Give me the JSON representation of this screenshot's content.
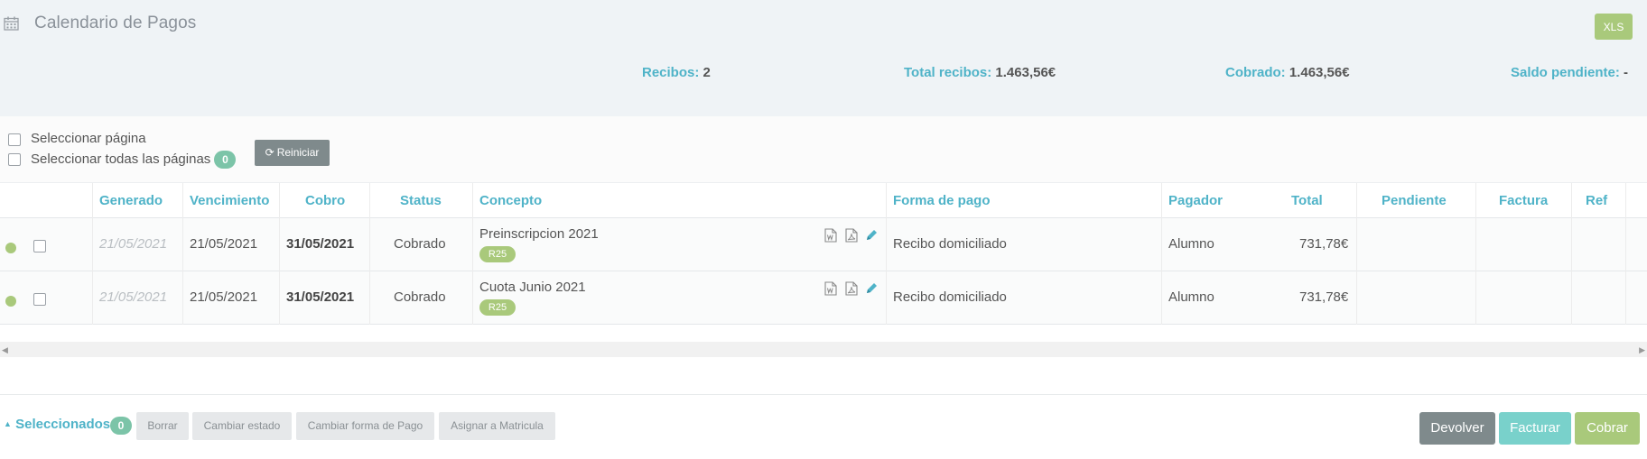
{
  "header": {
    "title": "Calendario de Pagos",
    "title_icon": "calendar-icon",
    "export_label": "XLS",
    "stats": [
      {
        "label": "Recibos:",
        "value": "2"
      },
      {
        "label": "Total recibos:",
        "value": "1.463,56€"
      },
      {
        "label": "Cobrado:",
        "value": "1.463,56€"
      },
      {
        "label": "Saldo pendiente:",
        "value": "-"
      }
    ]
  },
  "selection": {
    "select_page": "Seleccionar página",
    "select_all": "Seleccionar todas las páginas",
    "count": "0",
    "reset_label": "Reiniciar",
    "reset_icon": "refresh-icon"
  },
  "table": {
    "columns": [
      "Generado",
      "Vencimiento",
      "Cobro",
      "Status",
      "Concepto",
      "Forma de pago",
      "Pagador",
      "Total",
      "Pendiente",
      "Factura",
      "Ref"
    ],
    "rows": [
      {
        "generado": "21/05/2021",
        "vencimiento": "21/05/2021",
        "cobro": "31/05/2021",
        "status": "Cobrado",
        "concepto": "Preinscripcion 2021",
        "tag": "R25",
        "forma_pago": "Recibo domiciliado",
        "pagador": "Alumno",
        "total": "731,78€",
        "pendiente": "",
        "factura": "",
        "ref": ""
      },
      {
        "generado": "21/05/2021",
        "vencimiento": "21/05/2021",
        "cobro": "31/05/2021",
        "status": "Cobrado",
        "concepto": "Cuota Junio 2021",
        "tag": "R25",
        "forma_pago": "Recibo domiciliado",
        "pagador": "Alumno",
        "total": "731,78€",
        "pendiente": "",
        "factura": "",
        "ref": ""
      }
    ],
    "row_icons": [
      "word-file-icon",
      "pdf-file-icon",
      "pencil-icon"
    ]
  },
  "footer": {
    "selected_label": "Seleccionados",
    "selected_count": "0",
    "actions": [
      "Borrar",
      "Cambiar estado",
      "Cambiar forma de Pago",
      "Asignar a Matricula"
    ],
    "buttons": {
      "devolver": "Devolver",
      "facturar": "Facturar",
      "cobrar": "Cobrar"
    }
  },
  "colors": {
    "accent": "#4fb3c8",
    "green": "#a9c97b",
    "teal_button": "#79d1cb",
    "grey_button": "#7f8a8c",
    "header_bg": "#eff3f6"
  }
}
